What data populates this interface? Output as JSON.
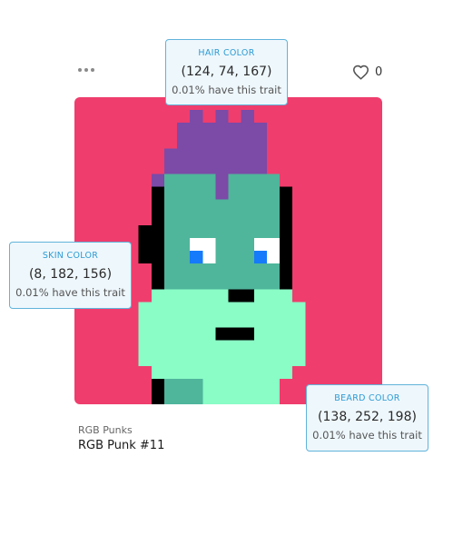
{
  "card": {
    "like_count": "0",
    "collection": "RGB Punks",
    "name": "RGB Punk #11"
  },
  "icons": {
    "menu": "more-horizontal-icon",
    "like": "heart-outline-icon"
  },
  "colors": {
    "background": "#EF3D6D",
    "hair": "#7C4AA7",
    "skin": "#4FB59B",
    "beard": "#8AFCC6",
    "outline": "#000000",
    "eye_white": "#FFFFFF",
    "eye_pupil": "#157BFB",
    "tooltip_border": "#61B3DA",
    "tooltip_label": "#2C9BD4"
  },
  "traits": {
    "hair": {
      "label": "HAIR COLOR",
      "value": "(124, 74, 167)",
      "rarity": "0.01% have this trait"
    },
    "skin": {
      "label": "SKIN COLOR",
      "value": "(8, 182, 156)",
      "rarity": "0.01% have this trait"
    },
    "beard": {
      "label": "BEARD COLOR",
      "value": "(138, 252, 198)",
      "rarity": "0.01% have this trait"
    }
  }
}
